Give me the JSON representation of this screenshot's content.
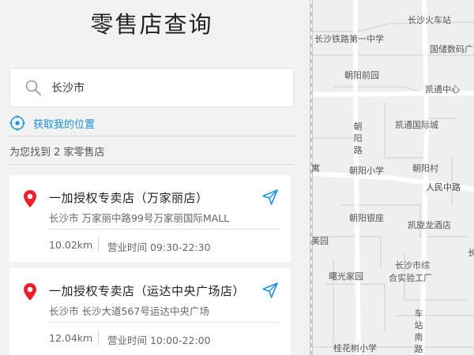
{
  "page": {
    "title": "零售店查询"
  },
  "search": {
    "value": "长沙市",
    "icon": "search-icon"
  },
  "locate": {
    "label": "获取我的位置",
    "icon": "locate-icon",
    "color": "#1c8fdb"
  },
  "results": {
    "summary": "为您找到 2 家零售店"
  },
  "stores": [
    {
      "name": "一加授权专卖店（万家丽店）",
      "address": "长沙市 万家丽中路99号万家丽国际MALL",
      "distance": "10.02km",
      "hours": "营业时间 09:30-22:30"
    },
    {
      "name": "一加授权专卖店（运达中央广场店）",
      "address": "长沙市 长沙大道567号运达中央广场",
      "distance": "12.04km",
      "hours": "营业时间 10:00-22:00"
    }
  ],
  "colors": {
    "pin": "#e8212d",
    "nav": "#1c8fdb"
  },
  "map": {
    "labels": [
      "长沙火车站",
      "长沙铁路第一中学",
      "国储数码广",
      "朝阳前园",
      "凯通中心",
      "朝阳路",
      "凯通国际城",
      "寓",
      "朝阳小学",
      "朝阳村",
      "人民中路",
      "朝阳银座",
      "凯旋龙酒店",
      "美园",
      "长沙市综",
      "合实验工厂",
      "曙光家园",
      "车站南路",
      "桂花树小学",
      "长"
    ]
  }
}
